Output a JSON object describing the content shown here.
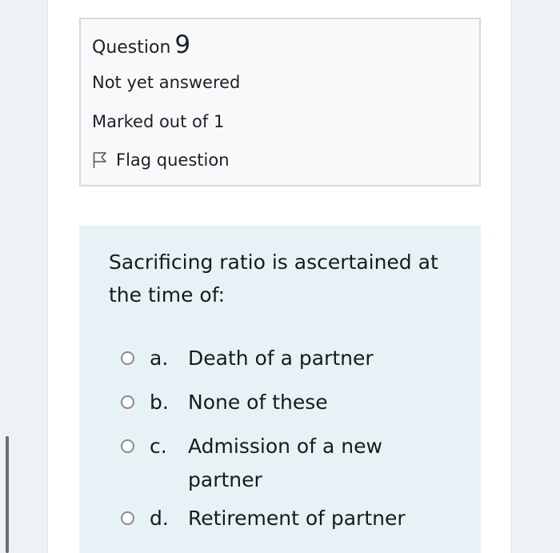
{
  "question_info": {
    "title_prefix": "Question",
    "number": "9",
    "state": "Not yet answered",
    "grade": "Marked out of 1",
    "flag_label": "Flag question"
  },
  "question": {
    "text": "Sacrificing ratio is ascertained at the time of:",
    "answers": [
      {
        "letter": "a.",
        "text": "Death of a partner"
      },
      {
        "letter": "b.",
        "text": "None of these"
      },
      {
        "letter": "c.",
        "text": "Admission of a new partner"
      },
      {
        "letter": "d.",
        "text": "Retirement of partner"
      }
    ]
  },
  "colors": {
    "info_background": "#f8f9fa",
    "info_border": "#d7d9dc",
    "question_background": "#e7f2f6",
    "side_background": "#eef1f5"
  }
}
